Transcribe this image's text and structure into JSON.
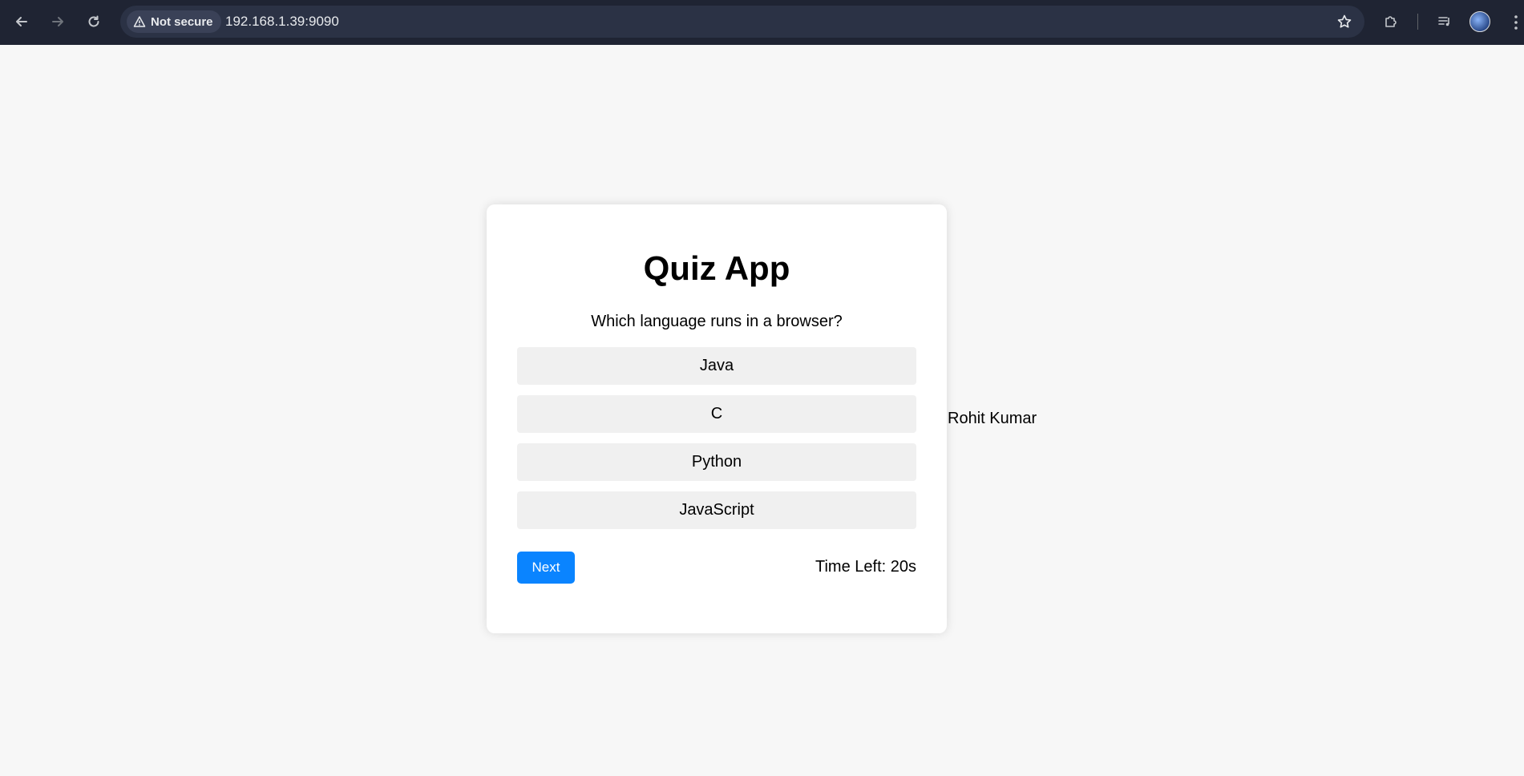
{
  "browser": {
    "security_label": "Not secure",
    "url": "192.168.1.39:9090"
  },
  "quiz": {
    "title": "Quiz App",
    "question": "Which language runs in a browser?",
    "options": [
      "Java",
      "C",
      "Python",
      "JavaScript"
    ],
    "next_label": "Next",
    "timer_text": "Time Left: 20s",
    "accent_color": "#0a84ff"
  },
  "footer_name": "Rohit Kumar"
}
